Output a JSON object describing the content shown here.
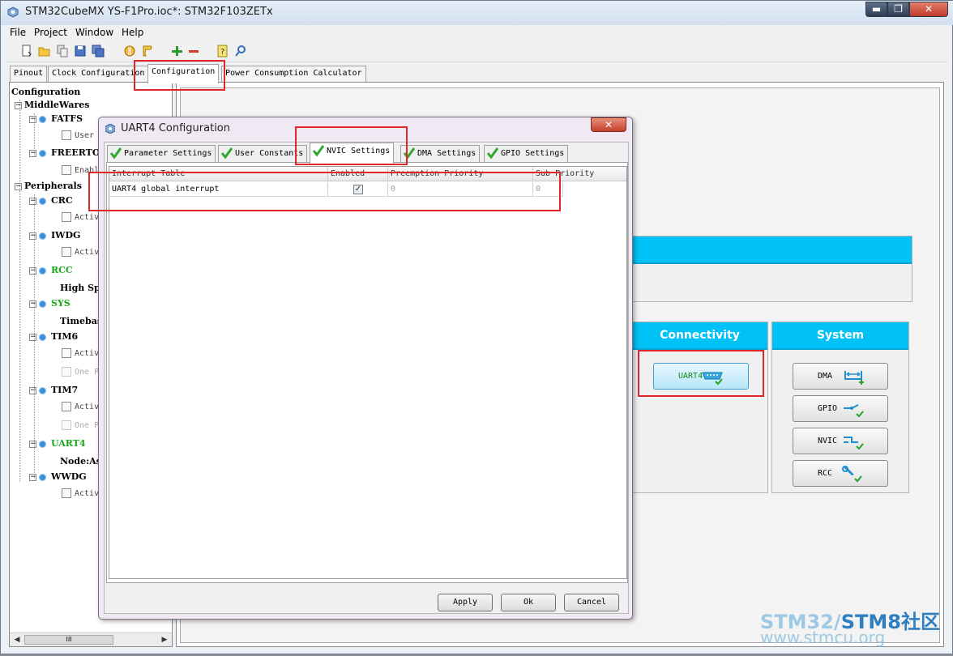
{
  "window": {
    "title": "STM32CubeMX YS-F1Pro.ioc*: STM32F103ZETx",
    "min_label": "▬",
    "max_label": "❐",
    "close_label": "✕"
  },
  "menu": [
    "File",
    "Project",
    "Window",
    "Help"
  ],
  "main_tabs": [
    "Pinout",
    "Clock Configuration",
    "Configuration",
    "Power Consumption Calculator"
  ],
  "tree": {
    "root": "Configuration",
    "middlewares": "MiddleWares",
    "fatfs": "FATFS",
    "fatfs_child": "User",
    "freertos": "FREERTO",
    "freertos_child": "Enabl",
    "peripherals": "Peripherals",
    "crc": "CRC",
    "crc_child": "Activ",
    "iwdg": "IWDG",
    "iwdg_child": "Activ",
    "rcc": "RCC",
    "rcc_child": "High Sp",
    "sys": "SYS",
    "sys_child": "Timebas",
    "tim6": "TIM6",
    "tim6_child1": "Activ",
    "tim6_child2": "One P",
    "tim7": "TIM7",
    "tim7_child1": "Activ",
    "tim7_child2": "One P",
    "uart4": "UART4",
    "uart4_child": "Node:As",
    "wwdg": "WWDG",
    "wwdg_child": "Activ",
    "scroll_thumb": "III"
  },
  "categories": {
    "connectivity": "Connectivity",
    "system": "System"
  },
  "peripheral_buttons": {
    "uart4": "UART4",
    "dma": "DMA",
    "gpio": "GPIO",
    "nvic": "NVIC",
    "rcc": "RCC"
  },
  "dialog": {
    "title": "UART4 Configuration",
    "close_label": "✕",
    "tabs": [
      "Parameter Settings",
      "User Constants",
      "NVIC Settings",
      "DMA Settings",
      "GPIO Settings"
    ],
    "table": {
      "columns": [
        "Interrupt Table",
        "Enabled",
        "Preemption Priority",
        "Sub Priority"
      ],
      "rows": [
        {
          "name": "UART4 global interrupt",
          "enabled_mark": "✓",
          "preemption": "0",
          "sub": "0"
        }
      ]
    },
    "buttons": {
      "apply": "Apply",
      "ok": "Ok",
      "cancel": "Cancel"
    }
  },
  "watermark": {
    "part1": "STM32/",
    "part2": "STM8社区",
    "url": "www.stmcu.org"
  },
  "colors": {
    "category_header": "#00c2f6",
    "highlight_box": "#e1262a",
    "enabled_green": "#18a818"
  }
}
